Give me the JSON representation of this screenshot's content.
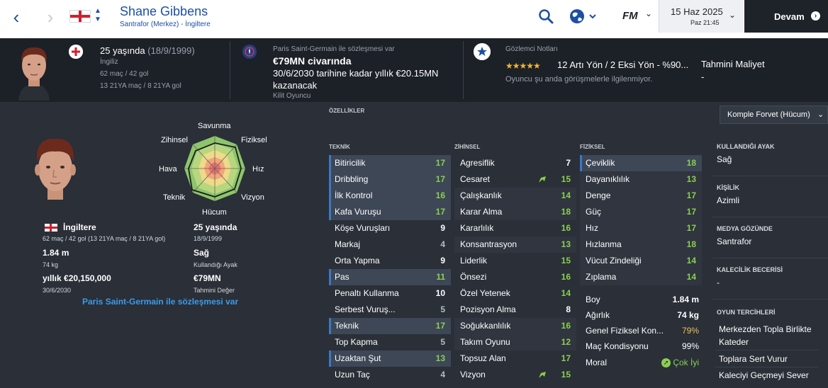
{
  "header": {
    "player_name": "Shane Gibbens",
    "player_sub": "Santrafor (Merkez) - İngiltere",
    "date": "15 Haz 2025",
    "day_time": "Paz 21:45",
    "continue_label": "Devam",
    "fm_logo": "FM"
  },
  "info": {
    "age": "25 yaşında",
    "birth": "(18/9/1999)",
    "nationality": "İngiliz",
    "apps": "62 maç / 42 gol",
    "u21": "13 21YA maç / 8 21YA gol",
    "contract_club": "Paris Saint-Germain ile sözleşmesi var",
    "value": "€79MN civarında",
    "wage_line1": "30/6/2030 tarihine kadar yıllık €20.15MN",
    "wage_line2": "kazanacak",
    "role_status": "Kilit Oyuncu",
    "scout_title": "Gözlemci Notları",
    "scout_summary": "12 Artı Yön / 2 Eksi Yön - %90...",
    "scout_note": "Oyuncu şu anda görüşmelerle ilgilenmiyor.",
    "est_cost_label": "Tahmini Maliyet",
    "est_cost_value": "-",
    "stars": "★★★★★",
    "stars_rating": 4.5
  },
  "radar": {
    "labels": {
      "top": "Savunma",
      "top_right": "Fiziksel",
      "right": "Hız",
      "bottom_right": "Vizyon",
      "bottom": "Hücum",
      "bottom_left": "Teknik",
      "left": "Hava",
      "top_left": "Zihinsel"
    }
  },
  "profile": {
    "country": "İngiltere",
    "caps": "62 maç / 42 gol (13 21YA maç / 8 21YA gol)",
    "height": "1.84 m",
    "weight": "74 kg",
    "wage": "yıllık €20,150,000",
    "contract_end": "30/6/2030",
    "age": "25 yaşında",
    "dob": "18/9/1999",
    "foot": "Sağ",
    "foot_label": "Kullandığı Ayak",
    "value": "€79MN",
    "value_label": "Tahmini Değer",
    "club_link": "Paris Saint-Germain ile sözleşmesi var"
  },
  "attributes": {
    "title": "ÖZELLİKLER",
    "role": "Komple Forvet (Hücum)",
    "teknik_head": "TEKNİK",
    "zihinsel_head": "ZİHİNSEL",
    "fiziksel_head": "FİZİKSEL",
    "teknik": [
      {
        "name": "Bitiricilik",
        "value": "17"
      },
      {
        "name": "Dribbling",
        "value": "17"
      },
      {
        "name": "İlk Kontrol",
        "value": "16"
      },
      {
        "name": "Kafa Vuruşu",
        "value": "17"
      },
      {
        "name": "Köşe Vuruşları",
        "value": "9"
      },
      {
        "name": "Markaj",
        "value": "4"
      },
      {
        "name": "Orta Yapma",
        "value": "9"
      },
      {
        "name": "Pas",
        "value": "11"
      },
      {
        "name": "Penaltı Kullanma",
        "value": "10"
      },
      {
        "name": "Serbest Vuruş...",
        "value": "5"
      },
      {
        "name": "Teknik",
        "value": "17"
      },
      {
        "name": "Top Kapma",
        "value": "5"
      },
      {
        "name": "Uzaktan Şut",
        "value": "13"
      },
      {
        "name": "Uzun Taç",
        "value": "4"
      }
    ],
    "zihinsel": [
      {
        "name": "Agresiflik",
        "value": "7"
      },
      {
        "name": "Cesaret",
        "value": "15"
      },
      {
        "name": "Çalışkanlık",
        "value": "14"
      },
      {
        "name": "Karar Alma",
        "value": "18"
      },
      {
        "name": "Kararlılık",
        "value": "16"
      },
      {
        "name": "Konsantrasyon",
        "value": "13"
      },
      {
        "name": "Liderlik",
        "value": "15"
      },
      {
        "name": "Önsezi",
        "value": "16"
      },
      {
        "name": "Özel Yetenek",
        "value": "14"
      },
      {
        "name": "Pozisyon Alma",
        "value": "8"
      },
      {
        "name": "Soğukkanlılık",
        "value": "16"
      },
      {
        "name": "Takım Oyunu",
        "value": "12"
      },
      {
        "name": "Topsuz Alan",
        "value": "17"
      },
      {
        "name": "Vizyon",
        "value": "15"
      }
    ],
    "fiziksel": [
      {
        "name": "Çeviklik",
        "value": "18"
      },
      {
        "name": "Dayanıklılık",
        "value": "13"
      },
      {
        "name": "Denge",
        "value": "17"
      },
      {
        "name": "Güç",
        "value": "17"
      },
      {
        "name": "Hız",
        "value": "17"
      },
      {
        "name": "Hızlanma",
        "value": "18"
      },
      {
        "name": "Vücut Zindeliği",
        "value": "14"
      },
      {
        "name": "Zıplama",
        "value": "14"
      }
    ],
    "phys_info": [
      {
        "name": "Boy",
        "value": "1.84 m"
      },
      {
        "name": "Ağırlık",
        "value": "74 kg"
      },
      {
        "name": "Genel Fiziksel Kon...",
        "value": "79%"
      },
      {
        "name": "Maç Kondisyonu",
        "value": "99%"
      },
      {
        "name": "Moral",
        "value": "Çok İyi"
      }
    ]
  },
  "right_panel": {
    "foot_head": "KULLANDIĞI AYAK",
    "foot_val": "Sağ",
    "personality_head": "KİŞİLİK",
    "personality_val": "Azimli",
    "media_head": "MEDYA GÖZÜNDE",
    "media_val": "Santrafor",
    "gk_head": "KALECİLİK BECERİSİ",
    "gk_val": "-",
    "prefs_head": "OYUN TERCİHLERİ",
    "prefs": [
      "Merkezden Topla Birlikte",
      "Kateder",
      "Toplara Sert Vurur",
      "Kaleciyi Geçmeyi Sever"
    ]
  },
  "colors": {
    "accent": "#1d4fa3",
    "good": "#8bcf4f",
    "link": "#3d9be9",
    "highlight": "#3d4756",
    "star": "#f0b43a"
  }
}
